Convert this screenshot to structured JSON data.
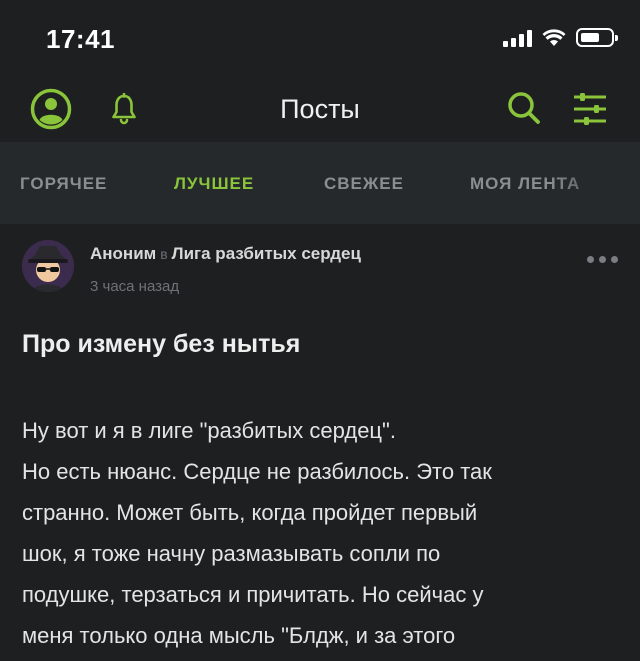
{
  "status_bar": {
    "time": "17:41"
  },
  "header": {
    "title": "Посты"
  },
  "tabs": [
    {
      "label": "ГОРЯЧЕЕ",
      "active": false
    },
    {
      "label": "ЛУЧШЕЕ",
      "active": true
    },
    {
      "label": "СВЕЖЕЕ",
      "active": false
    },
    {
      "label": "МОЯ ЛЕНТА",
      "active": false
    }
  ],
  "post": {
    "author": "Аноним",
    "in_word": "в",
    "community": "Лига разбитых сердец",
    "time_ago": "3 часа назад",
    "title": "Про измену без нытья",
    "body_lines": [
      "Ну вот и я в лиге \"разбитых сердец\".",
      "Но есть нюанс. Сердце не разбилось. Это так",
      "странно. Может быть, когда пройдет первый",
      "шок, я тоже начну размазывать сопли по",
      "подушке, терзаться и причитать. Но сейчас у",
      "меня только одна мысль \"Блдж, и за этого"
    ]
  },
  "colors": {
    "accent": "#8ac43a",
    "background": "#1d1f21",
    "tab_bar": "#26292c"
  },
  "icons": [
    "profile-icon",
    "bell-icon",
    "search-icon",
    "filter-icon",
    "more-icon"
  ]
}
